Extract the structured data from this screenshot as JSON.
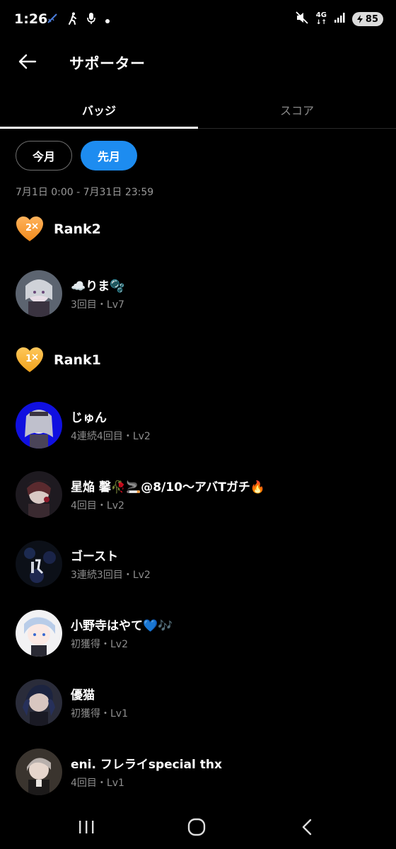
{
  "status": {
    "time": "1:26",
    "battery": "85",
    "network": "4G",
    "icons": [
      "pen-icon",
      "walking-icon",
      "mic-icon",
      "dot-icon",
      "mute-icon",
      "network-icon",
      "signal-icon",
      "battery-icon"
    ]
  },
  "header": {
    "title": "サポーター"
  },
  "tabs": [
    {
      "label": "バッジ",
      "active": true
    },
    {
      "label": "スコア",
      "active": false
    }
  ],
  "filters": [
    {
      "label": "今月",
      "selected": false
    },
    {
      "label": "先月",
      "selected": true
    }
  ],
  "date_range": "7月1日 0:00 - 7月31日 23:59",
  "ranks": [
    {
      "label": "Rank2",
      "number": "2"
    },
    {
      "label": "Rank1",
      "number": "1"
    }
  ],
  "users": [
    {
      "name": "☁️りま🫧",
      "meta": "3回目・Lv7"
    },
    {
      "name": "じゅん",
      "meta": "4連続4回目・Lv2"
    },
    {
      "name": "星焔 馨🥀🚬@8/10〜アバTガチ🔥",
      "meta": "4回目・Lv2"
    },
    {
      "name": "ゴースト",
      "meta": "3連続3回目・Lv2"
    },
    {
      "name": "小野寺はやて💙🎶",
      "meta": "初獲得・Lv2"
    },
    {
      "name": "優猫",
      "meta": "初獲得・Lv1"
    },
    {
      "name": "eni. フレライspecial thx",
      "meta": "4回目・Lv1"
    }
  ],
  "colors": {
    "accent": "#1d8cf0",
    "rank_heart": "#f5a623",
    "background": "#000000"
  }
}
